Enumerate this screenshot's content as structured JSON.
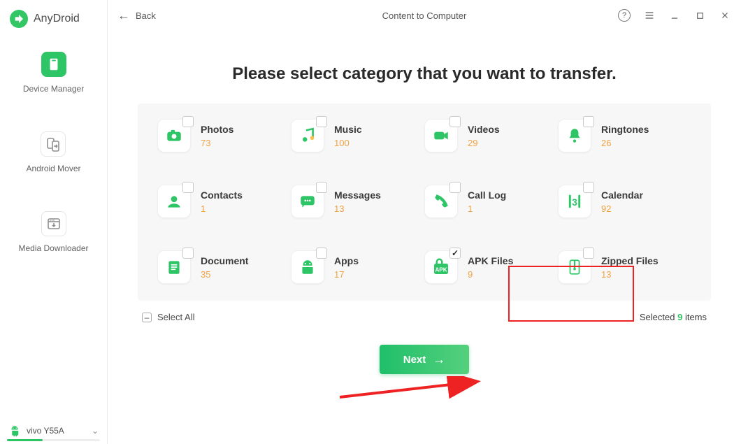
{
  "brand": {
    "name": "AnyDroid"
  },
  "sidebar": {
    "items": [
      {
        "label": "Device Manager"
      },
      {
        "label": "Android Mover"
      },
      {
        "label": "Media Downloader"
      }
    ]
  },
  "device": {
    "name": "vivo Y55A"
  },
  "header": {
    "back": "Back",
    "title": "Content to Computer"
  },
  "headline": "Please select category that you want to transfer.",
  "categories": [
    {
      "key": "photos",
      "name": "Photos",
      "count": "73",
      "icon": "camera"
    },
    {
      "key": "music",
      "name": "Music",
      "count": "100",
      "icon": "music"
    },
    {
      "key": "videos",
      "name": "Videos",
      "count": "29",
      "icon": "video"
    },
    {
      "key": "ringtones",
      "name": "Ringtones",
      "count": "26",
      "icon": "bell"
    },
    {
      "key": "contacts",
      "name": "Contacts",
      "count": "1",
      "icon": "contact"
    },
    {
      "key": "messages",
      "name": "Messages",
      "count": "13",
      "icon": "message"
    },
    {
      "key": "calllog",
      "name": "Call Log",
      "count": "1",
      "icon": "phone"
    },
    {
      "key": "calendar",
      "name": "Calendar",
      "count": "92",
      "icon": "calendar"
    },
    {
      "key": "document",
      "name": "Document",
      "count": "35",
      "icon": "document"
    },
    {
      "key": "apps",
      "name": "Apps",
      "count": "17",
      "icon": "android"
    },
    {
      "key": "apkfiles",
      "name": "APK Files",
      "count": "9",
      "icon": "apk",
      "checked": true
    },
    {
      "key": "zipped",
      "name": "Zipped Files",
      "count": "13",
      "icon": "zip"
    }
  ],
  "footer": {
    "selectAll": "Select All",
    "selectedPrefix": "Selected ",
    "selectedCount": "9",
    "selectedSuffix": " items"
  },
  "next": "Next",
  "colors": {
    "accent": "#2ec566",
    "count": "#f1a344",
    "highlight": "#e22"
  }
}
